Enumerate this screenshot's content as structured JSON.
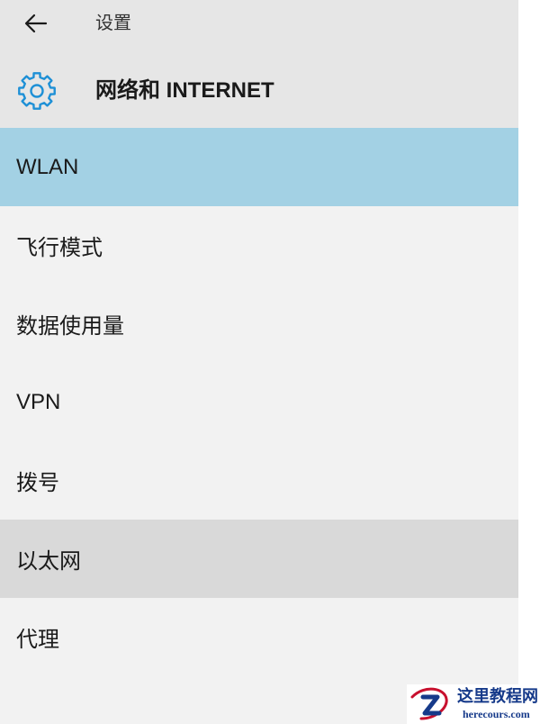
{
  "topbar": {
    "back_icon": "arrow-left-icon",
    "title": "设置"
  },
  "section": {
    "icon": "gear-icon",
    "title": "网络和 INTERNET",
    "accent_color": "#1e90d6"
  },
  "nav": {
    "selected_color": "#a3d1e4",
    "items": [
      {
        "label": "WLAN",
        "state": "selected"
      },
      {
        "label": "飞行模式",
        "state": "normal"
      },
      {
        "label": "数据使用量",
        "state": "normal"
      },
      {
        "label": "VPN",
        "state": "normal"
      },
      {
        "label": "拨号",
        "state": "normal"
      },
      {
        "label": "以太网",
        "state": "hover"
      },
      {
        "label": "代理",
        "state": "normal"
      }
    ]
  },
  "watermark": {
    "name": "这里教程网",
    "url": "herecours.com"
  }
}
